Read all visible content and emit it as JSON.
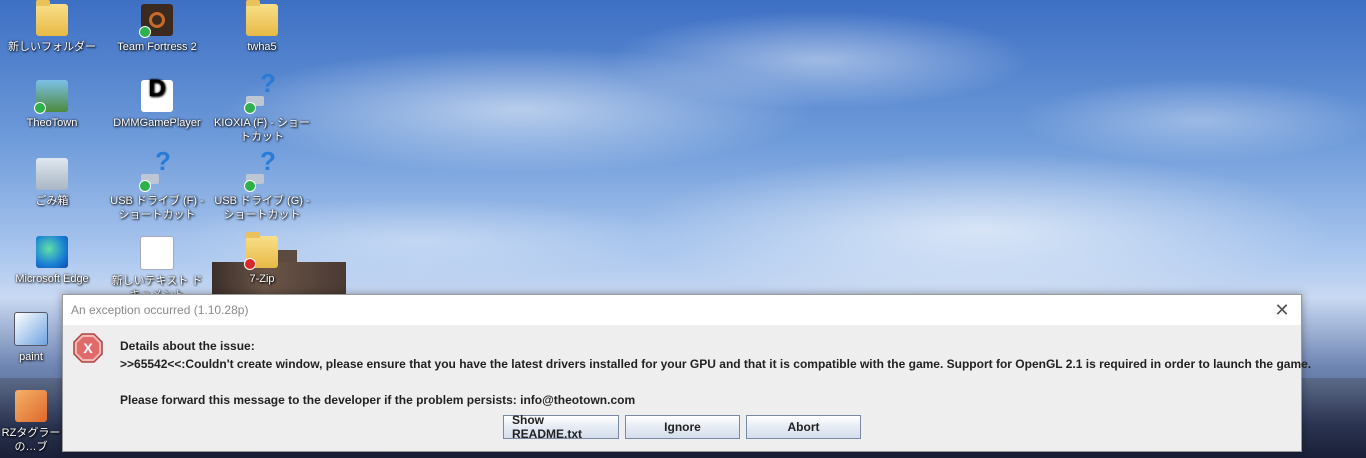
{
  "desktop": {
    "icons": [
      {
        "label": "新しいフォルダー",
        "icon": "folder-icon",
        "badge": "none"
      },
      {
        "label": "Team Fortress 2",
        "icon": "team-fortress-icon",
        "badge": "ok"
      },
      {
        "label": "twha5",
        "icon": "folder-icon",
        "badge": "none"
      },
      {
        "label": "TheoTown",
        "icon": "theotown-icon",
        "badge": "ok"
      },
      {
        "label": "DMMGamePlayer",
        "icon": "dmm-icon",
        "badge": "none"
      },
      {
        "label": "KIOXIA (F) - ショートカット",
        "icon": "drive-shortcut-icon",
        "badge": "ok"
      },
      {
        "label": "ごみ箱",
        "icon": "recycle-bin-icon",
        "badge": "none"
      },
      {
        "label": "USB ドライブ (F) - ショートカット",
        "icon": "drive-shortcut-icon",
        "badge": "ok"
      },
      {
        "label": "USB ドライブ (G) - ショートカット",
        "icon": "drive-shortcut-icon",
        "badge": "ok"
      },
      {
        "label": "Microsoft Edge",
        "icon": "edge-icon",
        "badge": "none"
      },
      {
        "label": "新しいテキスト ドキュメント",
        "icon": "text-document-icon",
        "badge": "none"
      },
      {
        "label": "7-Zip",
        "icon": "folder-icon",
        "badge": "error"
      },
      {
        "label": "paint",
        "icon": "paint-icon",
        "badge": "none"
      },
      {
        "label": "RZタグラーの…ブ",
        "icon": "rz-icon",
        "badge": "none"
      }
    ]
  },
  "dialog": {
    "title": "An exception occurred (1.10.28p)",
    "heading": "Details about the issue:",
    "message": ">>65542<<:Couldn't create window, please ensure that you have the latest drivers installed for your GPU and that it is compatible with the game. Support for OpenGL 2.1 is required in order to launch the game.",
    "forward": "Please forward this message to the developer if the problem persists: info@theotown.com",
    "buttons": {
      "readme": "Show README.txt",
      "ignore": "Ignore",
      "abort": "Abort"
    }
  },
  "colors": {
    "dialog_bg": "#eeeeee",
    "error_red": "#d8282c",
    "button_border": "#7a8aa6"
  }
}
